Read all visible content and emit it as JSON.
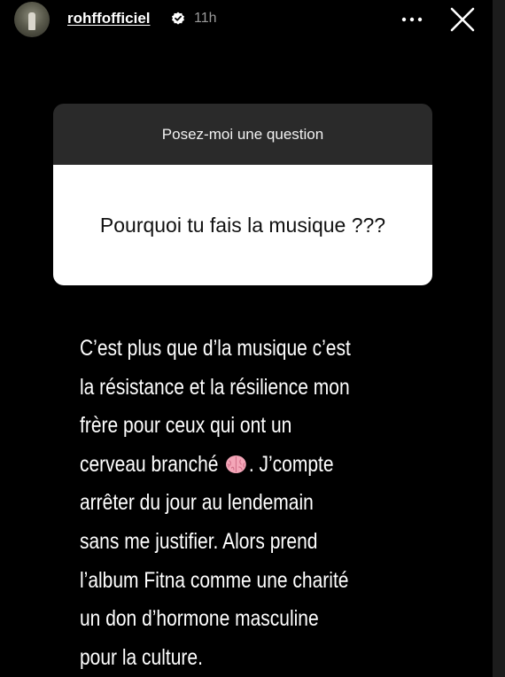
{
  "header": {
    "username": "rohffofficiel",
    "timestamp": "11h",
    "verified_icon": "verified-badge-icon",
    "more_icon": "more-options-icon",
    "close_icon": "close-icon"
  },
  "question_sticker": {
    "prompt": "Posez-moi une question",
    "question": "Pourquoi tu fais la musique ???"
  },
  "answer": {
    "lines": [
      "C’est plus que d’la musique c’est",
      "la résistance et la résilience mon",
      "frère pour ceux qui ont un",
      "cerveau branché",
      ". J’compte",
      "arrêter du jour au lendemain",
      "sans me justifier.  Alors prend",
      "l’album Fitna comme une charité",
      "un don d’hormone masculine",
      "pour la culture."
    ],
    "emoji": "brain-emoji-icon"
  },
  "colors": {
    "background": "#000000",
    "sticker_header": "#2a2a2a",
    "sticker_body": "#ffffff",
    "timestamp": "#9a9a9a"
  }
}
